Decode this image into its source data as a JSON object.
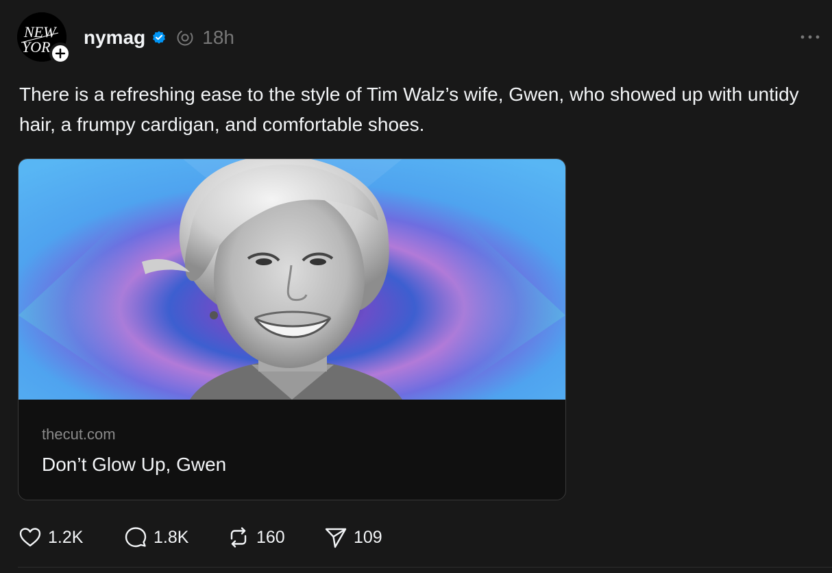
{
  "post": {
    "author": {
      "username": "nymag",
      "avatar_text": "NEW YORK",
      "verified_icon": "verified-badge-icon",
      "follow_icon": "plus-icon"
    },
    "timestamp": "18h",
    "text": "There is a refreshing ease to the style of Tim Walz’s wife, Gwen, who showed up with untidy hair, a frumpy cardigan, and comfortable shoes.",
    "link_card": {
      "domain": "thecut.com",
      "title": "Don’t Glow Up, Gwen"
    },
    "actions": {
      "likes": "1.2K",
      "replies": "1.8K",
      "reposts": "160",
      "shares": "109"
    }
  },
  "colors": {
    "background": "#181818",
    "text": "#f3f5f7",
    "muted": "#777777",
    "verified": "#0095f6",
    "card_border": "#3a3a3a"
  }
}
